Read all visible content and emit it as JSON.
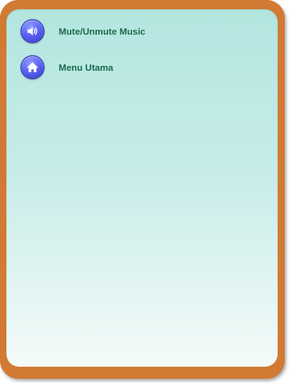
{
  "menu": {
    "items": [
      {
        "label": "Mute/Unmute Music",
        "icon": "speaker-icon"
      },
      {
        "label": "Menu Utama",
        "icon": "home-icon"
      }
    ]
  },
  "colors": {
    "frame": "#d27a33",
    "panel_top": "#b3e6e0",
    "panel_bottom": "#f4fbfa",
    "label": "#1d6b4e",
    "icon_button": "#5a63f2"
  }
}
